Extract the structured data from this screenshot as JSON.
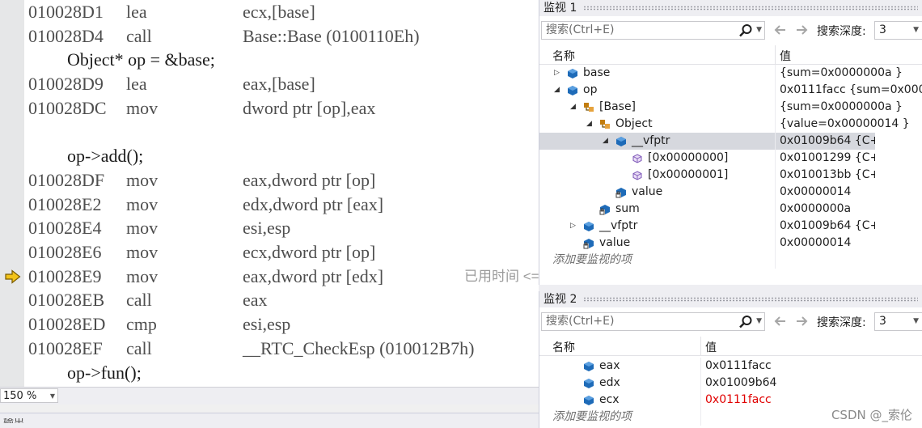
{
  "disassembly": {
    "lines": [
      {
        "kind": "asm",
        "addr": "010028D1",
        "op": "lea",
        "arg": "ecx,[base]"
      },
      {
        "kind": "asm",
        "addr": "010028D4",
        "op": "call",
        "arg": "Base::Base (0100110Eh)"
      },
      {
        "kind": "src",
        "text": "Object* op = &base;"
      },
      {
        "kind": "asm",
        "addr": "010028D9",
        "op": "lea",
        "arg": "eax,[base]"
      },
      {
        "kind": "asm",
        "addr": "010028DC",
        "op": "mov",
        "arg": "dword ptr [op],eax"
      },
      {
        "kind": "blank",
        "text": ""
      },
      {
        "kind": "src",
        "text": "op->add();"
      },
      {
        "kind": "asm",
        "addr": "010028DF",
        "op": "mov",
        "arg": "eax,dword ptr [op]"
      },
      {
        "kind": "asm",
        "addr": "010028E2",
        "op": "mov",
        "arg": "edx,dword ptr [eax]"
      },
      {
        "kind": "asm",
        "addr": "010028E4",
        "op": "mov",
        "arg": "esi,esp"
      },
      {
        "kind": "asm",
        "addr": "010028E6",
        "op": "mov",
        "arg": "ecx,dword ptr [op]"
      },
      {
        "kind": "asm",
        "addr": "010028E9",
        "op": "mov",
        "arg": "eax,dword ptr [edx]",
        "current": true,
        "note": "已用时间 <="
      },
      {
        "kind": "asm",
        "addr": "010028EB",
        "op": "call",
        "arg": "eax"
      },
      {
        "kind": "asm",
        "addr": "010028ED",
        "op": "cmp",
        "arg": "esi,esp"
      },
      {
        "kind": "asm",
        "addr": "010028EF",
        "op": "call",
        "arg": "__RTC_CheckEsp (010012B7h)"
      },
      {
        "kind": "src",
        "text": "op->fun();"
      }
    ],
    "zoom": "150 %",
    "bottom_tab": "输出"
  },
  "watch1": {
    "title": "监视 1",
    "search_placeholder": "搜索(Ctrl+E)",
    "depth_label": "搜索深度:",
    "depth_value": "3",
    "col_name": "名称",
    "col_value": "值",
    "rows": [
      {
        "indent": 0,
        "twisty": "collapsed",
        "icon": "variable-icon",
        "name": "base",
        "value": "{sum=0x0000000a }"
      },
      {
        "indent": 0,
        "twisty": "expanded",
        "icon": "variable-icon",
        "name": "op",
        "value": "0x0111facc {sum=0x0000"
      },
      {
        "indent": 1,
        "twisty": "expanded",
        "icon": "base-class-icon",
        "name": "[Base]",
        "value": "{sum=0x0000000a }"
      },
      {
        "indent": 2,
        "twisty": "expanded",
        "icon": "base-class-icon",
        "name": "Object",
        "value": "{value=0x00000014 }"
      },
      {
        "indent": 3,
        "twisty": "expanded",
        "icon": "variable-icon",
        "name": "__vfptr",
        "value": "0x01009b64 {C++",
        "selected": true
      },
      {
        "indent": 4,
        "twisty": "none",
        "icon": "array-element-icon",
        "name": "[0x00000000]",
        "value": "0x01001299 {C++:"
      },
      {
        "indent": 4,
        "twisty": "none",
        "icon": "array-element-icon",
        "name": "[0x00000001]",
        "value": "0x010013bb {C++"
      },
      {
        "indent": 3,
        "twisty": "none",
        "icon": "field-icon",
        "name": "value",
        "value": "0x00000014"
      },
      {
        "indent": 2,
        "twisty": "none",
        "icon": "field-icon",
        "name": "sum",
        "value": "0x0000000a"
      },
      {
        "indent": 1,
        "twisty": "collapsed",
        "icon": "variable-icon",
        "name": "__vfptr",
        "value": "0x01009b64 {C++"
      },
      {
        "indent": 1,
        "twisty": "none",
        "icon": "field-icon",
        "name": "value",
        "value": "0x00000014"
      }
    ],
    "add_item": "添加要监视的项"
  },
  "watch2": {
    "title": "监视 2",
    "search_placeholder": "搜索(Ctrl+E)",
    "depth_label": "搜索深度:",
    "depth_value": "3",
    "col_name": "名称",
    "col_value": "值",
    "rows": [
      {
        "indent": 1,
        "twisty": "none",
        "icon": "variable-icon",
        "name": "eax",
        "value": "0x0111facc"
      },
      {
        "indent": 1,
        "twisty": "none",
        "icon": "variable-icon",
        "name": "edx",
        "value": "0x01009b64"
      },
      {
        "indent": 1,
        "twisty": "none",
        "icon": "variable-icon",
        "name": "ecx",
        "value": "0x0111facc",
        "changed": true
      }
    ],
    "add_item": "添加要监视的项"
  },
  "watermark": "CSDN @_索伦",
  "colors": {
    "accent_icon": "#1e6bb8",
    "base_class_icon": "#c27d0e",
    "current_line_arrow": "#f2c31b",
    "changed_value": "#e00000"
  }
}
